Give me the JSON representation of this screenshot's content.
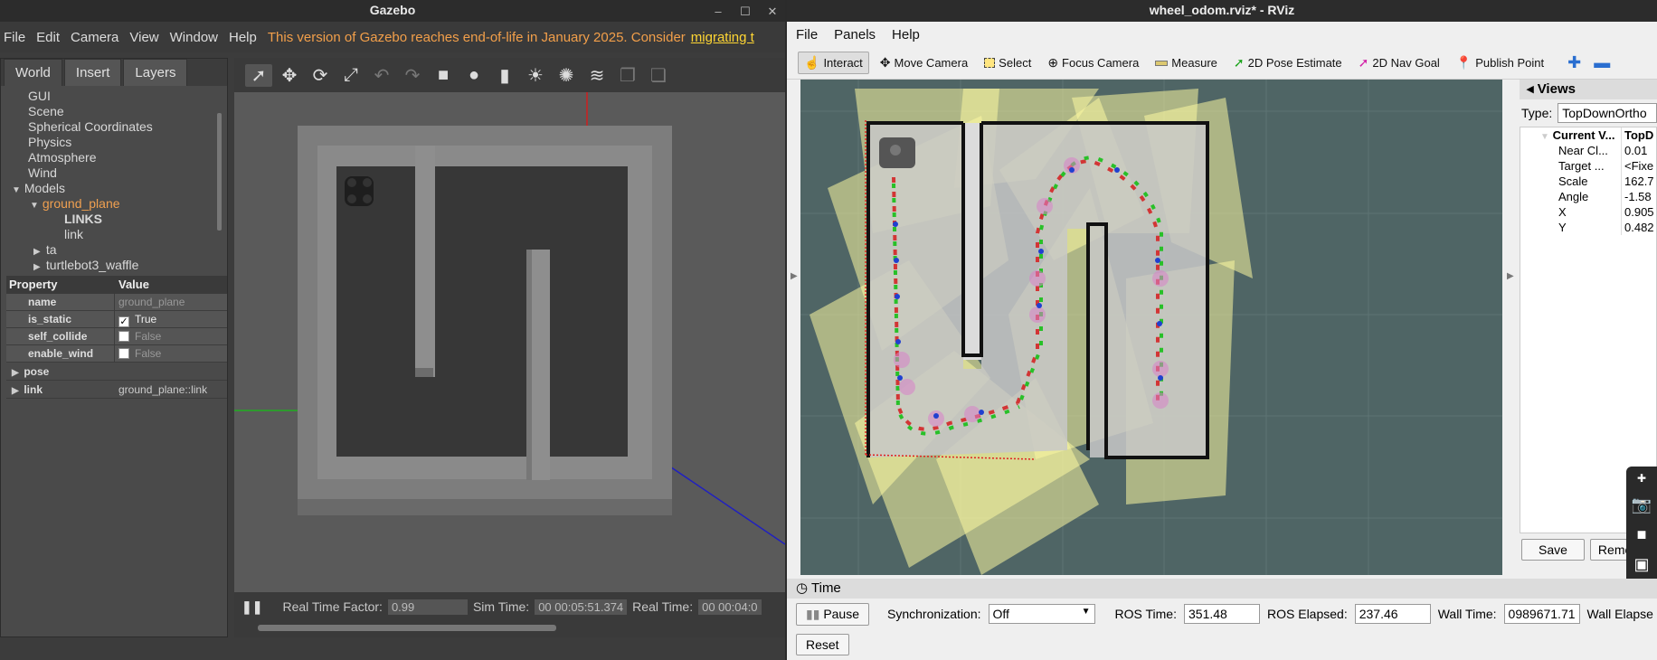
{
  "gazebo": {
    "title": "Gazebo",
    "menu": [
      "File",
      "Edit",
      "Camera",
      "View",
      "Window",
      "Help"
    ],
    "warning": "This version of Gazebo reaches end-of-life in January 2025. Consider",
    "warning_link": "migrating t",
    "tabs": [
      "World",
      "Insert",
      "Layers"
    ],
    "tree": [
      {
        "label": "GUI",
        "indent": 1
      },
      {
        "label": "Scene",
        "indent": 1
      },
      {
        "label": "Spherical Coordinates",
        "indent": 1
      },
      {
        "label": "Physics",
        "indent": 1
      },
      {
        "label": "Atmosphere",
        "indent": 1
      },
      {
        "label": "Wind",
        "indent": 1
      },
      {
        "label": "Models",
        "indent": 0
      },
      {
        "label": "ground_plane",
        "indent": 1
      },
      {
        "label": "LINKS",
        "indent": 3
      },
      {
        "label": "link",
        "indent": 3
      },
      {
        "label": "ta",
        "indent": 2
      },
      {
        "label": "turtlebot3_waffle",
        "indent": 2
      }
    ],
    "prop_header": {
      "property": "Property",
      "value": "Value"
    },
    "props": [
      {
        "name": "name",
        "value": "ground_plane",
        "checkbox": false
      },
      {
        "name": "is_static",
        "value": "True",
        "checkbox": true,
        "checked": true
      },
      {
        "name": "self_collide",
        "value": "False",
        "checkbox": true,
        "checked": false
      },
      {
        "name": "enable_wind",
        "value": "False",
        "checkbox": true,
        "checked": false
      }
    ],
    "groups": [
      {
        "name": "pose",
        "value": ""
      },
      {
        "name": "link",
        "value": "ground_plane::link"
      }
    ],
    "status": {
      "rtf_label": "Real Time Factor:",
      "rtf": "0.99",
      "sim_label": "Sim Time:",
      "sim": "00 00:05:51.374",
      "real_label": "Real Time:",
      "real": "00 00:04:0"
    }
  },
  "rviz": {
    "title": "wheel_odom.rviz* - RViz",
    "menu": [
      "File",
      "Panels",
      "Help"
    ],
    "tools": [
      {
        "label": "Interact",
        "icon": "hand-icon"
      },
      {
        "label": "Move Camera",
        "icon": "move-icon"
      },
      {
        "label": "Select",
        "icon": "select-icon"
      },
      {
        "label": "Focus Camera",
        "icon": "focus-icon"
      },
      {
        "label": "Measure",
        "icon": "ruler-icon"
      },
      {
        "label": "2D Pose Estimate",
        "icon": "arrow-green-icon"
      },
      {
        "label": "2D Nav Goal",
        "icon": "arrow-pink-icon"
      },
      {
        "label": "Publish Point",
        "icon": "pin-icon"
      }
    ],
    "views": {
      "header": "Views",
      "type_label": "Type:",
      "type_value": "TopDownOrtho",
      "current_view": "Current V...",
      "current_value": "TopD",
      "props": [
        {
          "k": "Near Cl...",
          "v": "0.01"
        },
        {
          "k": "Target ...",
          "v": "<Fixe"
        },
        {
          "k": "Scale",
          "v": "162.7"
        },
        {
          "k": "Angle",
          "v": "-1.58"
        },
        {
          "k": "X",
          "v": "0.905"
        },
        {
          "k": "Y",
          "v": "0.482"
        }
      ],
      "save": "Save",
      "remove": "Remov"
    },
    "time": {
      "header": "Time",
      "pause": "Pause",
      "sync_label": "Synchronization:",
      "sync_value": "Off",
      "ros_time_label": "ROS Time:",
      "ros_time": "351.48",
      "ros_elapsed_label": "ROS Elapsed:",
      "ros_elapsed": "237.46",
      "wall_time_label": "Wall Time:",
      "wall_time": "0989671.71",
      "wall_elapsed_label": "Wall Elapse",
      "reset": "Reset"
    }
  }
}
